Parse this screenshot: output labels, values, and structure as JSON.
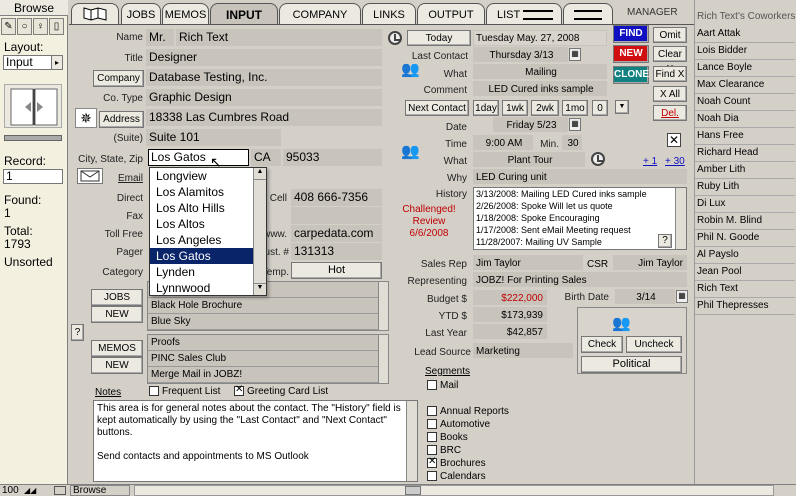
{
  "left": {
    "mode": "Browse",
    "layout_label": "Layout:",
    "layout_value": "Input",
    "record_label": "Record:",
    "record_value": "1",
    "found_label": "Found:",
    "found_value": "1",
    "total_label": "Total:",
    "total_value": "1793",
    "sort_state": "Unsorted"
  },
  "tabs": [
    "JOBS",
    "MEMOS",
    "INPUT",
    "COMPANY",
    "LINKS",
    "OUTPUT",
    "LIST"
  ],
  "manager": {
    "label": "MANAGER",
    "find": "FIND",
    "new": "NEW",
    "clone": "CLONE",
    "omit": "Omit",
    "clear_x": "Clear X",
    "find_x": "Find X",
    "x_all": "X All",
    "del": "Del."
  },
  "contact": {
    "name_label": "Name",
    "prefix": "Mr.",
    "name": "Rich Text",
    "title_label": "Title",
    "title": "Designer",
    "company_label": "Company",
    "company": "Database Testing, Inc.",
    "cotype_label": "Co. Type",
    "cotype": "Graphic Design",
    "address_label": "Address",
    "address": "18338 Las Cumbres Road",
    "suite_label": "(Suite)",
    "suite": "Suite 101",
    "csz_label": "City, State, Zip",
    "city": "Los Gatos",
    "state": "CA",
    "zip": "95033",
    "email_label": "Email",
    "direct_label": "Direct",
    "cell_label": "Cell",
    "cell": "408 666-7356",
    "fax_label": "Fax",
    "tollfree_label": "Toll Free",
    "www_label": "www.",
    "www": "carpedata.com",
    "pager_label": "Pager",
    "cust_label": "Cust. #",
    "cust": "131313",
    "category_label": "Category",
    "temp_label": "Temp.",
    "temp_value": "Hot"
  },
  "city_options": [
    "Longview",
    "Los Alamitos",
    "Los Alto Hills",
    "Los Altos",
    "Los Angeles",
    "Los Gatos",
    "Lynden",
    "Lynnwood"
  ],
  "city_selected_index": 5,
  "jobs": {
    "jobs_btn": "JOBS",
    "new_btn": "NEW",
    "items": [
      "",
      "Black Hole Brochure",
      "Blue Sky"
    ]
  },
  "memos": {
    "memos_btn": "MEMOS",
    "new_btn": "NEW",
    "items": [
      "Proofs",
      "PINC Sales Club",
      "Merge Mail in JOBZ!"
    ]
  },
  "notes": {
    "label": "Notes",
    "frequent_list": "Frequent List",
    "greeting_card_list": "Greeting Card List",
    "text": "This area is for general notes about the contact. The \"History\" field is kept automatically by using the \"Last Contact\" and \"Next Contact\" buttons.\n\nSend contacts and appointments to MS Outlook"
  },
  "activity": {
    "today_btn": "Today",
    "today_value": "Tuesday May. 27, 2008",
    "last_contact_label": "Last Contact",
    "last_contact": "Thursday 3/13",
    "what_label": "What",
    "what_last": "Mailing",
    "comment_label": "Comment",
    "comment": "LED Cured inks sample",
    "next_contact_btn": "Next Contact",
    "next_offsets": [
      "1day",
      "1wk",
      "2wk",
      "1mo",
      "0"
    ],
    "date_label": "Date",
    "date": "Friday 5/23",
    "time_label": "Time",
    "time": "9:00 AM",
    "min_label": "Min.",
    "min": "30",
    "what_next": "Plant Tour",
    "plus1": "+ 1",
    "plus30": "+ 30",
    "why_label": "Why",
    "why": "LED Curing unit",
    "history_label": "History",
    "challenge": "Challenged!\nReview\n6/6/2008",
    "history": [
      "3/13/2008: Mailing LED Cured inks sample",
      "2/26/2008: Spoke Will let us quote",
      "1/18/2008: Spoke Encouraging",
      "1/17/2008: Sent eMail Meeting request",
      "11/28/2007: Mailing UV Sample"
    ],
    "history_q": "?"
  },
  "sales": {
    "rep_label": "Sales Rep",
    "rep": "Jim Taylor",
    "csr_label": "CSR",
    "csr": "Jim Taylor",
    "representing_label": "Representing",
    "representing": "JOBZ! For Printing Sales",
    "budget_label": "Budget $",
    "budget": "$222,000",
    "birth_label": "Birth Date",
    "birth": "3/14",
    "ytd_label": "YTD $",
    "ytd": "$173,939",
    "lastyear_label": "Last Year",
    "lastyear": "$42,857",
    "leadsource_label": "Lead Source",
    "leadsource": "Marketing",
    "check_btn": "Check",
    "uncheck_btn": "Uncheck",
    "political_btn": "Political",
    "segments_label": "Segments",
    "segments": [
      {
        "label": "Mail",
        "checked": false
      },
      {
        "label": "Annual Reports",
        "checked": false
      },
      {
        "label": "Automotive",
        "checked": false
      },
      {
        "label": "Books",
        "checked": false
      },
      {
        "label": "BRC",
        "checked": false
      },
      {
        "label": "Brochures",
        "checked": true
      },
      {
        "label": "Calendars",
        "checked": false
      }
    ]
  },
  "coworkers": {
    "title": "Rich Text's Coworkers",
    "items": [
      "Aart Attak",
      "Lois Bidder",
      "Lance Boyle",
      "Max Clearance",
      "Noah Count",
      "Noah Dia",
      "Hans Free",
      "Richard Head",
      "Amber Lith",
      "Ruby Lith",
      "Di Lux",
      "Robin M. Blind",
      "Phil N. Goode",
      "Al Payslo",
      "Jean Pool",
      "Rich Text",
      "Phil Thepresses"
    ]
  },
  "status": {
    "zoom": "100",
    "mode": "Browse"
  },
  "colors": {
    "find": "#1010c0",
    "new": "#d01010",
    "clone": "#108080",
    "budget": "#c00000",
    "challenge": "#c00000",
    "selected": "#0a246a"
  }
}
